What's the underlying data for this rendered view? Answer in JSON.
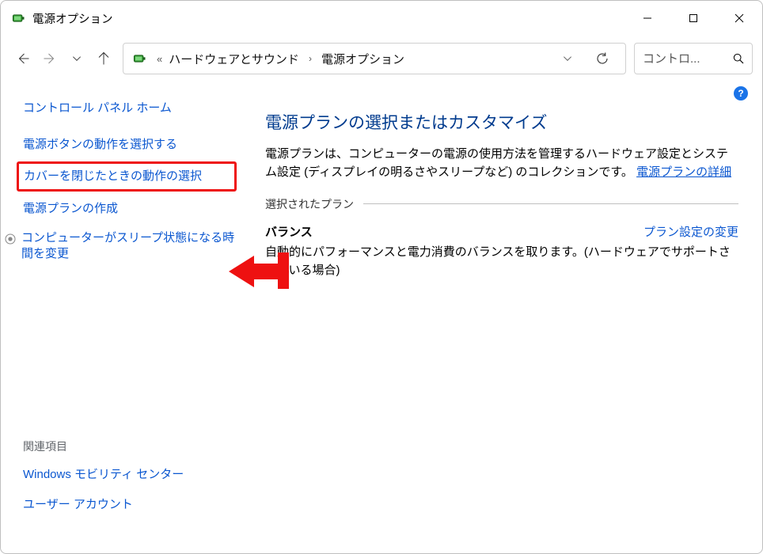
{
  "window": {
    "title": "電源オプション"
  },
  "breadcrumb": {
    "part1": "ハードウェアとサウンド",
    "part2": "電源オプション"
  },
  "search": {
    "placeholder": "コントロ..."
  },
  "help_badge": "?",
  "leftnav": {
    "home": "コントロール パネル ホーム",
    "link1": "電源ボタンの動作を選択する",
    "link2": "カバーを閉じたときの動作の選択",
    "link3": "電源プランの作成",
    "link4": "コンピューターがスリープ状態になる時間を変更",
    "related_heading": "関連項目",
    "related1": "Windows モビリティ センター",
    "related2": "ユーザー アカウント"
  },
  "main": {
    "heading": "電源プランの選択またはカスタマイズ",
    "desc_pre": "電源プランは、コンピューターの電源の使用方法を管理するハードウェア設定とシステム設定 (ディスプレイの明るさやスリープなど) のコレクションです。",
    "desc_link": "電源プランの詳細",
    "section_label": "選択されたプラン",
    "plan_name": "バランス",
    "plan_change": "プラン設定の変更",
    "plan_desc": "自動的にパフォーマンスと電力消費のバランスを取ります。(ハードウェアでサポートされている場合)"
  }
}
